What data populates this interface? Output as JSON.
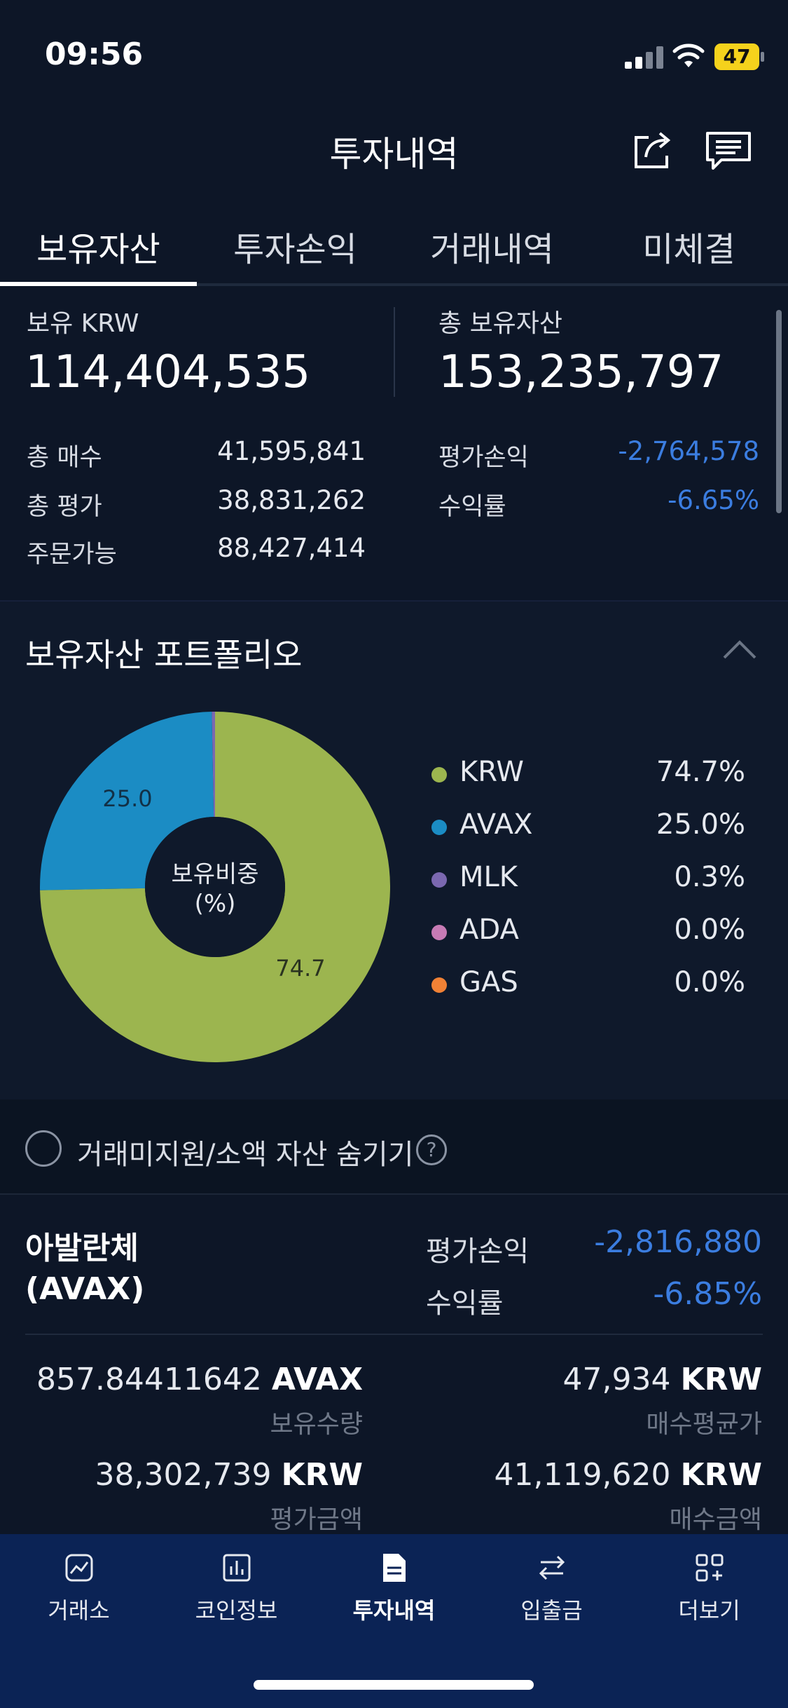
{
  "status_bar": {
    "time": "09:56",
    "battery": "47"
  },
  "header": {
    "title": "투자내역",
    "share_icon": "share-icon",
    "chat_icon": "chat-icon"
  },
  "tabs": [
    {
      "label": "보유자산",
      "active": true
    },
    {
      "label": "투자손익",
      "active": false
    },
    {
      "label": "거래내역",
      "active": false
    },
    {
      "label": "미체결",
      "active": false
    }
  ],
  "summary": {
    "krw_label": "보유 KRW",
    "krw_value": "114,404,535",
    "total_label": "총 보유자산",
    "total_value": "153,235,797",
    "rows_left": [
      {
        "label": "총 매수",
        "value": "41,595,841"
      },
      {
        "label": "총 평가",
        "value": "38,831,262"
      },
      {
        "label": "주문가능",
        "value": "88,427,414"
      }
    ],
    "rows_right": [
      {
        "label": "평가손익",
        "value": "-2,764,578"
      },
      {
        "label": "수익률",
        "value": "-6.65%"
      }
    ]
  },
  "portfolio": {
    "title": "보유자산 포트폴리오",
    "center_label_1": "보유비중",
    "center_label_2": "(%)",
    "slice_label_krw": "74.7",
    "slice_label_avax": "25.0",
    "legend": [
      {
        "name": "KRW",
        "pct": "74.7%",
        "color": "#9cb54f"
      },
      {
        "name": "AVAX",
        "pct": "25.0%",
        "color": "#1b8cc4"
      },
      {
        "name": "MLK",
        "pct": "0.3%",
        "color": "#7b68b0"
      },
      {
        "name": "ADA",
        "pct": "0.0%",
        "color": "#c77bb5"
      },
      {
        "name": "GAS",
        "pct": "0.0%",
        "color": "#f08135"
      }
    ]
  },
  "chart_data": {
    "type": "pie",
    "categories": [
      "KRW",
      "AVAX",
      "MLK",
      "ADA",
      "GAS"
    ],
    "values": [
      74.7,
      25.0,
      0.3,
      0.0,
      0.0
    ],
    "title": ""
  },
  "hide_small": {
    "label": "거래미지원/소액 자산 숨기기",
    "help": "?"
  },
  "asset": {
    "name_line1": "아발란체",
    "name_line2": "(AVAX)",
    "pnl_label": "평가손익",
    "pnl_value": "-2,816,880",
    "rate_label": "수익률",
    "rate_value": "-6.85%",
    "qty_value": "857.84411642",
    "qty_unit": "AVAX",
    "qty_sub": "보유수량",
    "avg_value": "47,934",
    "avg_unit": "KRW",
    "avg_sub": "매수평균가",
    "eval_value": "38,302,739",
    "eval_unit": "KRW",
    "eval_sub": "평가금액",
    "buy_value": "41,119,620",
    "buy_unit": "KRW",
    "buy_sub": "매수금액"
  },
  "bottom_nav": [
    {
      "label": "거래소",
      "icon": "exchange-chart-icon"
    },
    {
      "label": "코인정보",
      "icon": "bar-chart-icon"
    },
    {
      "label": "투자내역",
      "icon": "document-icon",
      "active": true
    },
    {
      "label": "입출금",
      "icon": "transfer-arrows-icon"
    },
    {
      "label": "더보기",
      "icon": "more-grid-icon"
    }
  ]
}
